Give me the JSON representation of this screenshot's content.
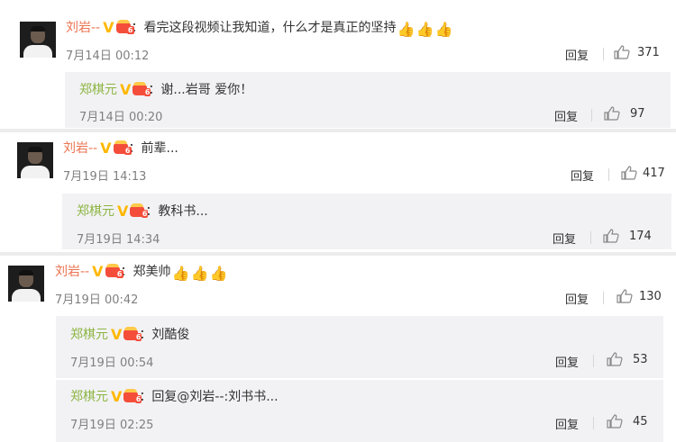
{
  "reply_label": "回复",
  "comments": [
    {
      "user": "刘岩--",
      "verified_mark": "V",
      "vip_level": "6",
      "text": "：看完这段视频让我知道，什么才是真正的坚持",
      "time": "7月14日 00:12",
      "likes": "371",
      "replies": [
        {
          "user": "郑棋元",
          "verified_mark": "V",
          "vip_level": "6",
          "text": "：谢...岩哥 爱你！",
          "time": "7月14日 00:20",
          "likes": "97"
        }
      ]
    },
    {
      "user": "刘岩--",
      "verified_mark": "V",
      "vip_level": "6",
      "text": "：前辈...",
      "time": "7月19日 14:13",
      "likes": "417",
      "replies": [
        {
          "user": "郑棋元",
          "verified_mark": "V",
          "vip_level": "6",
          "text": "：教科书...",
          "time": "7月19日 14:34",
          "likes": "174"
        }
      ]
    },
    {
      "user": "刘岩--",
      "verified_mark": "V",
      "vip_level": "6",
      "text": "：郑美帅",
      "time": "7月19日 00:42",
      "likes": "130",
      "replies": [
        {
          "user": "郑棋元",
          "verified_mark": "V",
          "vip_level": "6",
          "text": "：刘酷俊",
          "time": "7月19日 00:54",
          "likes": "53"
        },
        {
          "user": "郑棋元",
          "verified_mark": "V",
          "vip_level": "6",
          "text": "：回复@刘岩--:刘书书...",
          "time": "7月19日 02:25",
          "likes": "45"
        }
      ]
    }
  ],
  "icons": {
    "thumbs_up_emoji": "👍",
    "like": "like-outline-icon"
  },
  "colors": {
    "username_main": "#eb7350",
    "username_reply": "#8db542",
    "verified": "#ffb800",
    "sub_bg": "#f2f2f5"
  }
}
